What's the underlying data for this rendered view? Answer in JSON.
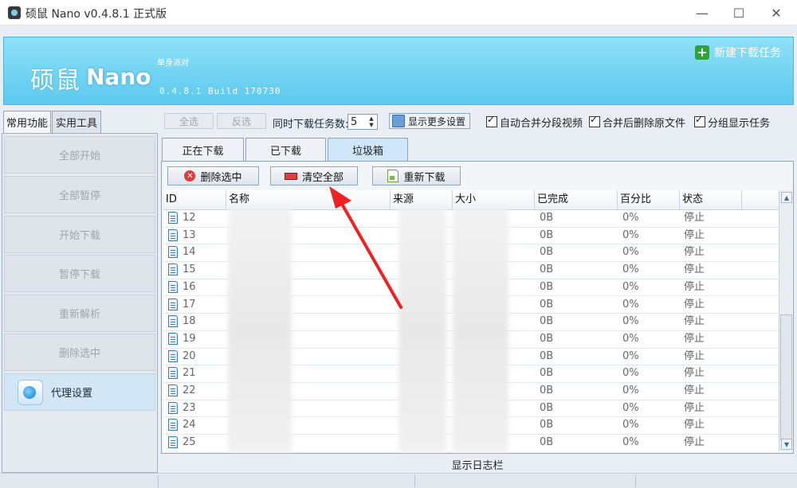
{
  "window": {
    "title": "硕鼠 Nano v0.4.8.1 正式版",
    "controls": {
      "minimize": "—",
      "maximize": "☐",
      "close": "✕"
    }
  },
  "banner": {
    "logo_cn": "硕鼠",
    "logo_en": "Nano",
    "tagline": "单身派对",
    "build": "0.4.8.1 Build 170730",
    "new_task": "新建下载任务"
  },
  "left_tabs": [
    "常用功能",
    "实用工具"
  ],
  "left_buttons": [
    "全部开始",
    "全部暂停",
    "开始下载",
    "暂停下载",
    "重新解析",
    "删除选中",
    "代理设置"
  ],
  "toolbar": {
    "select_all": "全选",
    "invert": "反选",
    "concurrent_label": "同时下载任务数:",
    "concurrent_value": "5",
    "more_settings": "显示更多设置",
    "merge_segments": "自动合并分段视频",
    "delete_after_merge": "合并后删除原文件",
    "group_tasks": "分组显示任务"
  },
  "main_tabs": [
    "正在下载",
    "已下载",
    "垃圾箱"
  ],
  "actions": {
    "delete_selected": "删除选中",
    "clear_all": "清空全部",
    "redownload": "重新下载"
  },
  "table": {
    "columns": [
      "ID",
      "名称",
      "来源",
      "大小",
      "已完成",
      "百分比",
      "状态"
    ],
    "rows": [
      {
        "id": "12",
        "done": "0B",
        "percent": "0%",
        "status": "停止"
      },
      {
        "id": "13",
        "done": "0B",
        "percent": "0%",
        "status": "停止"
      },
      {
        "id": "14",
        "done": "0B",
        "percent": "0%",
        "status": "停止"
      },
      {
        "id": "15",
        "done": "0B",
        "percent": "0%",
        "status": "停止"
      },
      {
        "id": "16",
        "done": "0B",
        "percent": "0%",
        "status": "停止"
      },
      {
        "id": "17",
        "done": "0B",
        "percent": "0%",
        "status": "停止"
      },
      {
        "id": "18",
        "done": "0B",
        "percent": "0%",
        "status": "停止"
      },
      {
        "id": "19",
        "done": "0B",
        "percent": "0%",
        "status": "停止"
      },
      {
        "id": "20",
        "done": "0B",
        "percent": "0%",
        "status": "停止"
      },
      {
        "id": "21",
        "done": "0B",
        "percent": "0%",
        "status": "停止"
      },
      {
        "id": "22",
        "done": "0B",
        "percent": "0%",
        "status": "停止"
      },
      {
        "id": "23",
        "done": "0B",
        "percent": "0%",
        "status": "停止"
      },
      {
        "id": "24",
        "done": "0B",
        "percent": "0%",
        "status": "停止"
      },
      {
        "id": "25",
        "done": "0B",
        "percent": "0%",
        "status": "停止"
      }
    ]
  },
  "log_bar": "显示日志栏",
  "colors": {
    "banner": "#5cc9ef",
    "accent": "#cfe5f8",
    "annotation": "#ee2222"
  }
}
